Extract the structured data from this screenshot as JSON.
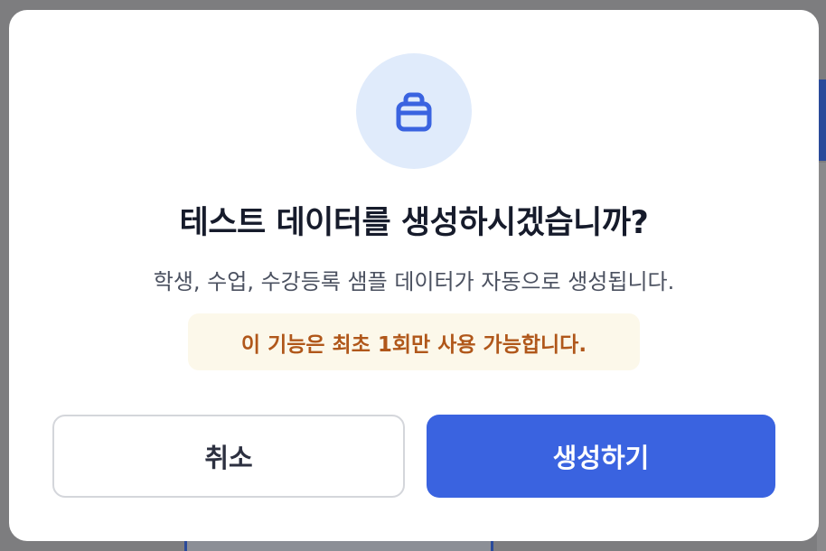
{
  "dialog": {
    "icon": "database-icon",
    "title": "테스트 데이터를 생성하시겠습니까?",
    "description": "학생, 수업, 수강등록 샘플 데이터가 자동으로 생성됩니다.",
    "notice": "이 기능은 최초 1회만 사용 가능합니다.",
    "cancel_label": "취소",
    "confirm_label": "생성하기"
  },
  "colors": {
    "primary": "#3a63e0",
    "icon_background": "#e0ebfb",
    "notice_background": "#fcf8ea",
    "notice_text": "#b0571a"
  }
}
